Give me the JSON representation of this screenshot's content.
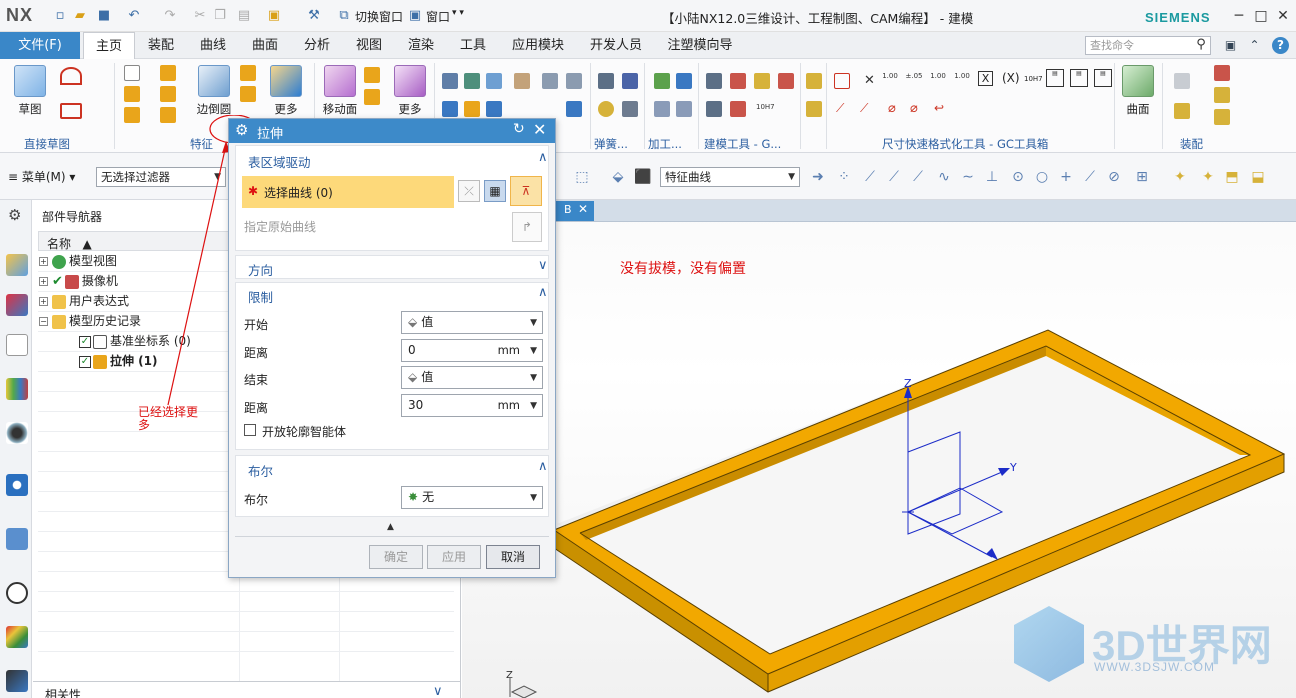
{
  "titlebar": {
    "app": "NX",
    "title": "【小陆NX12.0三维设计、工程制图、CAM编程】 - 建模",
    "brand": "SIEMENS",
    "switch_window": "切换窗口",
    "window": "窗口"
  },
  "menu": {
    "file": "文件(F)",
    "tabs": [
      "主页",
      "装配",
      "曲线",
      "曲面",
      "分析",
      "视图",
      "渲染",
      "工具",
      "应用模块",
      "开发人员",
      "注塑模向导"
    ],
    "search_placeholder": "查找命令"
  },
  "ribbon": {
    "sketch": "草图",
    "direct_sketch": "直接草图",
    "feature": "特征",
    "edge_blend": "边倒圆",
    "more1": "更多",
    "move_face": "移动面",
    "more2": "更多",
    "spring": "弹簧...",
    "machining": "加工...",
    "build_tools": "建模工具 - G...",
    "dimension_tools": "尺寸快速格式化工具 - GC工具箱",
    "surface": "曲面",
    "assembly": "装配",
    "num_a": "1.00",
    "num_b": "±.05",
    "h7a": "10H7",
    "h7b": "10H7"
  },
  "selbar": {
    "menu": "菜单(M)",
    "filter": "无选择过滤器",
    "curve_rule": "特征曲线"
  },
  "navigator": {
    "title": "部件导航器",
    "column_name": "名称",
    "items": [
      {
        "label": "模型视图"
      },
      {
        "label": "摄像机"
      },
      {
        "label": "用户表达式"
      },
      {
        "label": "模型历史记录"
      },
      {
        "label": "基准坐标系 (0)"
      },
      {
        "label": "拉伸 (1)"
      }
    ],
    "related": "相关性"
  },
  "dialog": {
    "title": "拉伸",
    "section_region": "表区域驱动",
    "select_curve": "选择曲线 (0)",
    "specify_curve": "指定原始曲线",
    "section_direction": "方向",
    "section_limits": "限制",
    "start_label": "开始",
    "start_value": "值",
    "start_dist_label": "距离",
    "start_dist": "0",
    "end_label": "结束",
    "end_value": "值",
    "end_dist_label": "距离",
    "end_dist": "30",
    "unit": "mm",
    "open_profile": "开放轮廓智能体",
    "section_bool": "布尔",
    "bool_label": "布尔",
    "bool_value": "无",
    "ok": "确定",
    "apply": "应用",
    "cancel": "取消"
  },
  "annotations": {
    "top_note": "没有拔模，没有偏置",
    "left_note": "已经选择更多"
  },
  "viewport": {
    "axis_z": "Z",
    "axis_y": "Y",
    "axis_x": "X",
    "watermark": "3D世界网",
    "watermark_url": "WWW.3DSJW.COM"
  },
  "colors": {
    "accent": "#3a87c8",
    "part": "#f2a800",
    "annotation": "#dd1111"
  }
}
